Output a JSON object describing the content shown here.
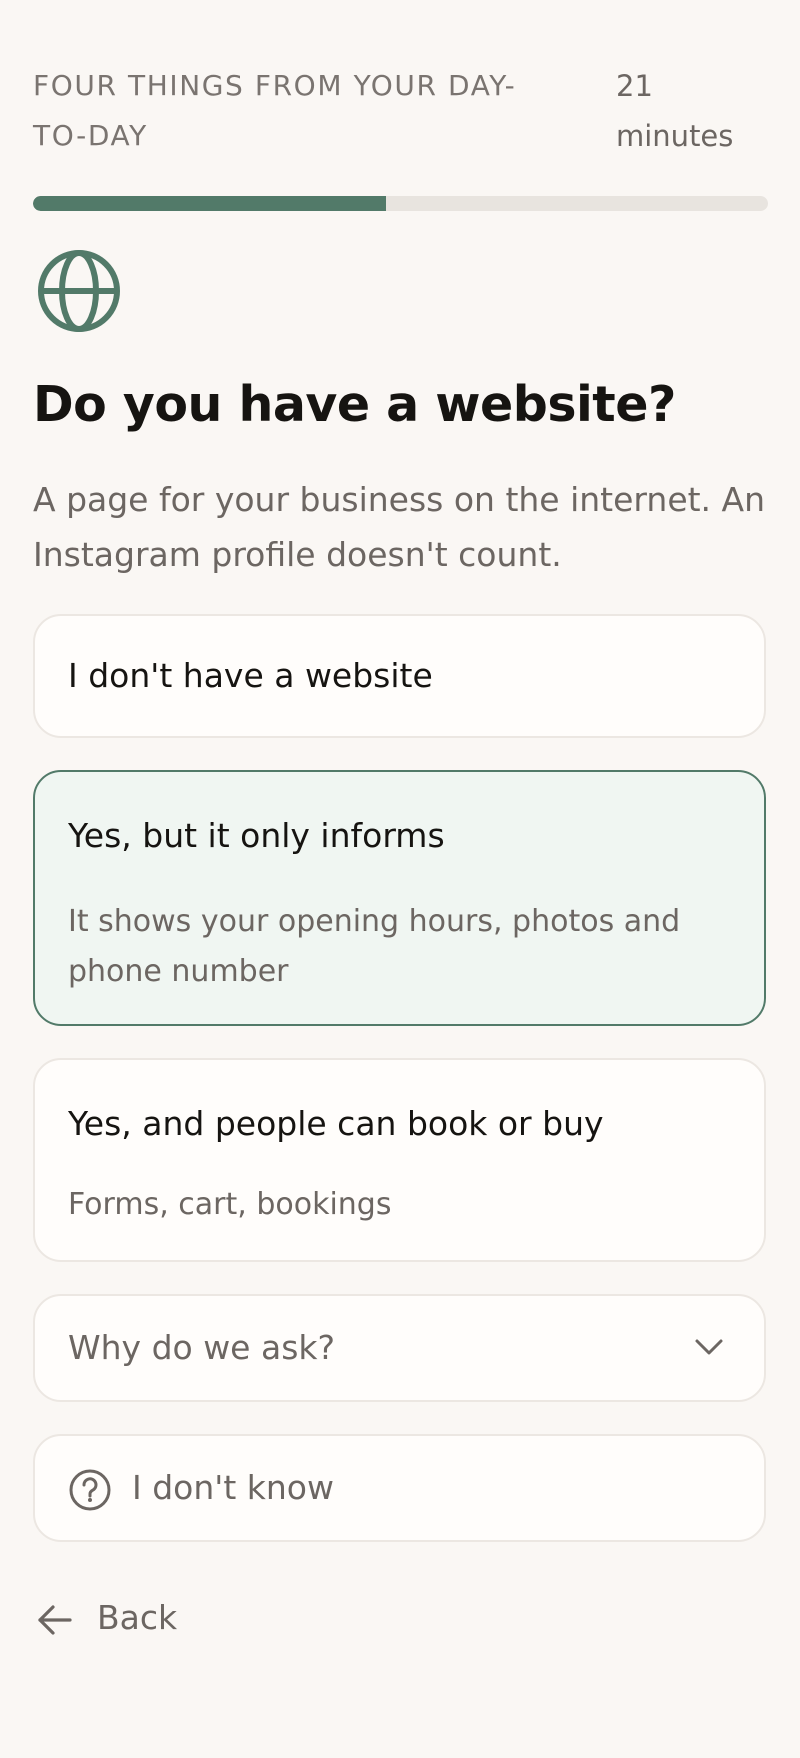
{
  "header": {
    "step_label": "FOUR THINGS FROM YOUR DAY-TO-DAY",
    "time_label": "21 minutes"
  },
  "progress": {
    "fraction": 0.48
  },
  "question": {
    "icon": "globe-icon",
    "title": "Do you have a website?",
    "description": "A page for your business on the internet. An Instagram profile doesn't count."
  },
  "options": [
    {
      "label": "I don't have a website",
      "sublabel": "",
      "selected": false
    },
    {
      "label": "Yes, but it only informs",
      "sublabel": "It shows your opening hours, photos and phone number",
      "selected": true
    },
    {
      "label": "Yes, and people can book or buy",
      "sublabel": "Forms, cart, bookings",
      "selected": false
    }
  ],
  "faq": {
    "label": "Why do we ask?",
    "icon": "chevron-down-icon"
  },
  "unknown": {
    "label": "I don't know",
    "icon": "question-circle-icon"
  },
  "nav": {
    "back_label": "Back",
    "back_icon": "arrow-left-icon"
  },
  "colors": {
    "accent": "#527a69",
    "selected_bg": "#f0f6f2",
    "background": "#faf7f4",
    "track": "#e8e4df"
  }
}
